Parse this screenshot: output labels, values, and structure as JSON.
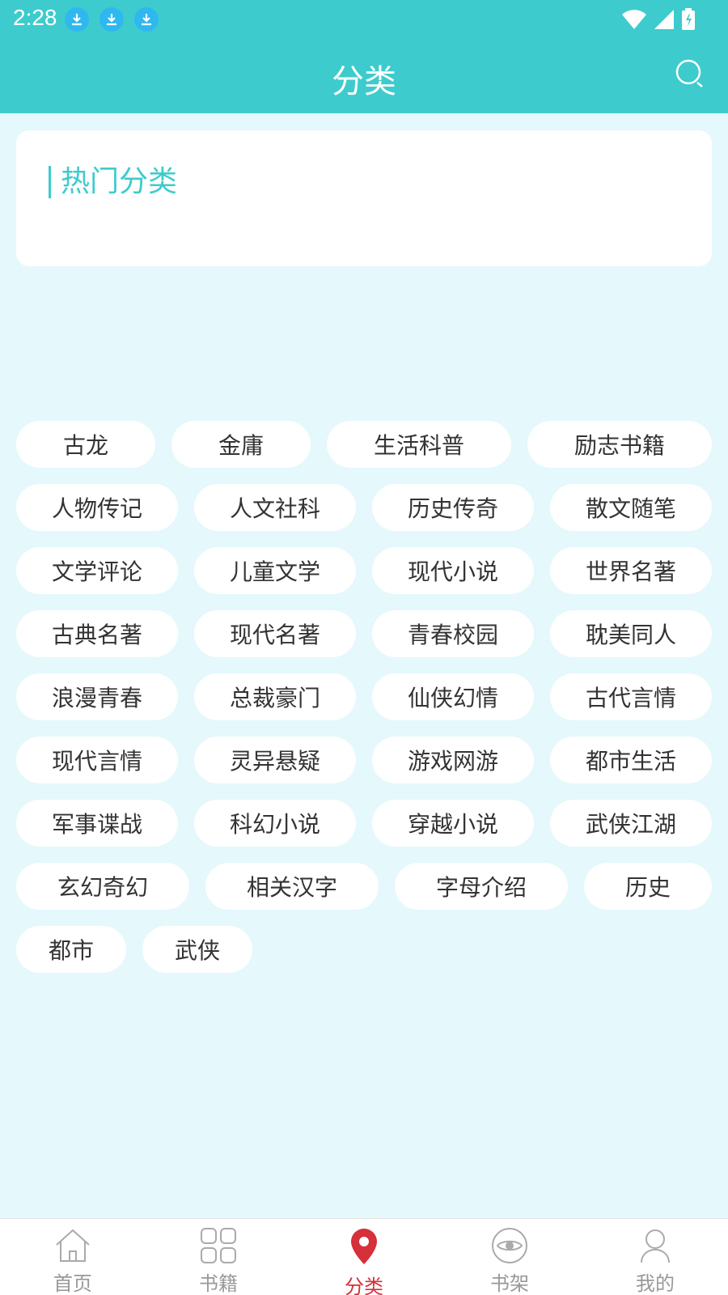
{
  "status": {
    "time": "2:28"
  },
  "header": {
    "title": "分类"
  },
  "hot": {
    "title": "热门分类"
  },
  "tag_rows": [
    [
      "古龙",
      "金庸",
      "生活科普",
      "励志书籍"
    ],
    [
      "人物传记",
      "人文社科",
      "历史传奇",
      "散文随笔"
    ],
    [
      "文学评论",
      "儿童文学",
      "现代小说",
      "世界名著"
    ],
    [
      "古典名著",
      "现代名著",
      "青春校园",
      "耽美同人"
    ],
    [
      "浪漫青春",
      "总裁豪门",
      "仙侠幻情",
      "古代言情"
    ],
    [
      "现代言情",
      "灵异悬疑",
      "游戏网游",
      "都市生活"
    ],
    [
      "军事谍战",
      "科幻小说",
      "穿越小说",
      "武侠江湖"
    ],
    [
      "玄幻奇幻",
      "相关汉字",
      "字母介绍",
      "历史"
    ],
    [
      "都市",
      "武侠"
    ]
  ],
  "nav": {
    "home": "首页",
    "books": "书籍",
    "category": "分类",
    "shelf": "书架",
    "mine": "我的"
  },
  "colors": {
    "accent": "#3ecbcd",
    "active": "#d6303a",
    "background": "#e5f8fb"
  }
}
